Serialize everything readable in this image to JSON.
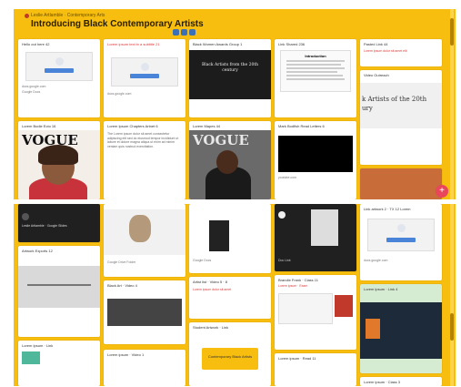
{
  "top": {
    "breadcrumb": "Leslie Artlamble · Contemporary Arts",
    "title": "Introducing Black Contemporary Artists"
  },
  "cards_top": [
    {
      "title": "Hello out here 42"
    },
    {
      "title": "Lorem ipsum text in a subtitle 21"
    },
    {
      "title": "Black Women Awards Group 1"
    },
    {
      "title": "Link Shared 236"
    },
    {
      "title": "Pasted Link 44"
    },
    {
      "title": "Lorem Bodie Ecto 16"
    },
    {
      "title": "Lorem Ipsum Chapters Artnet 6"
    },
    {
      "title": "Lorem Mapes 44"
    },
    {
      "title": "Mark Bodfish Read Letters 6"
    },
    {
      "title": "Video Outreach"
    }
  ],
  "card_texts": {
    "ppt_line1": "Black Artists from the 20th",
    "ppt_line2": "century",
    "ppt_big": "k Artists of the 20th",
    "ppt_big2": "ury",
    "vogue": "VOGUE",
    "doc_head": "Introduction"
  },
  "cards_bottom": [
    {
      "title": "Leslie Artlamble · Google Slides"
    },
    {
      "title": "Google Drive Folder"
    },
    {
      "title": "Google Docs"
    },
    {
      "title": "Doc Link"
    },
    {
      "title": "Artwork Exports 12"
    },
    {
      "title": "Link artwork 2 · TX 12 Lorem"
    },
    {
      "title": "Black Art · Video 4"
    },
    {
      "title": "Artist list · Video 5 · 8"
    },
    {
      "title": "Brandie Frank · Class 11"
    },
    {
      "title": "Lorem ipsum · Exam"
    },
    {
      "title": "Lorem ipsum · Video 1"
    },
    {
      "title": "Student Artwork · Link"
    },
    {
      "title": "Lorem Ipsum · Link"
    },
    {
      "title": "Contemporary Black Artists"
    },
    {
      "title": "Lorem ipsum · Read 11"
    },
    {
      "title": "Lorem ipsum · Link 4"
    },
    {
      "title": "Brandie Frank · Class 4"
    },
    {
      "title": "Lorem ipsum · Class 3"
    }
  ],
  "fab": "+"
}
